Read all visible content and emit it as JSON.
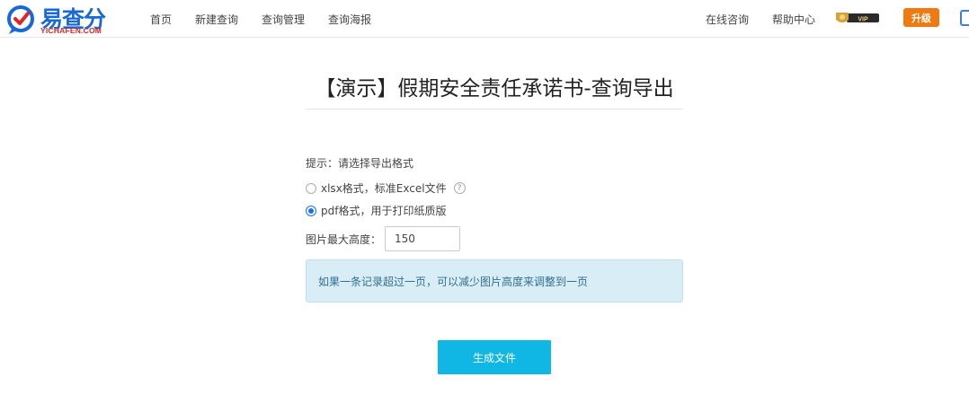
{
  "brand": {
    "name": "易查分",
    "domain": "YICHAFEN.COM",
    "primary_color": "#1769d8",
    "accent_color": "#e02424"
  },
  "nav": {
    "left": [
      {
        "label": "首页"
      },
      {
        "label": "新建查询"
      },
      {
        "label": "查询管理"
      },
      {
        "label": "查询海报"
      }
    ],
    "right": [
      {
        "label": "在线咨询"
      },
      {
        "label": "帮助中心"
      }
    ],
    "vip_label": "VIP",
    "upgrade_label": "升级"
  },
  "page": {
    "title": "【演示】假期安全责任承诺书-查询导出",
    "hint": "提示：请选择导出格式",
    "options": [
      {
        "label": "xlsx格式，标准Excel文件",
        "checked": false
      },
      {
        "label": "pdf格式，用于打印纸质版",
        "checked": true
      }
    ],
    "height_label": "图片最大高度：",
    "height_value": "150",
    "info": "如果一条记录超过一页，可以减少图片高度来调整到一页",
    "generate_label": "生成文件"
  },
  "colors": {
    "button": "#11b7e4",
    "upgrade": "#f07a12",
    "info_bg": "#d9edf6",
    "radio": "#1a73e8"
  }
}
